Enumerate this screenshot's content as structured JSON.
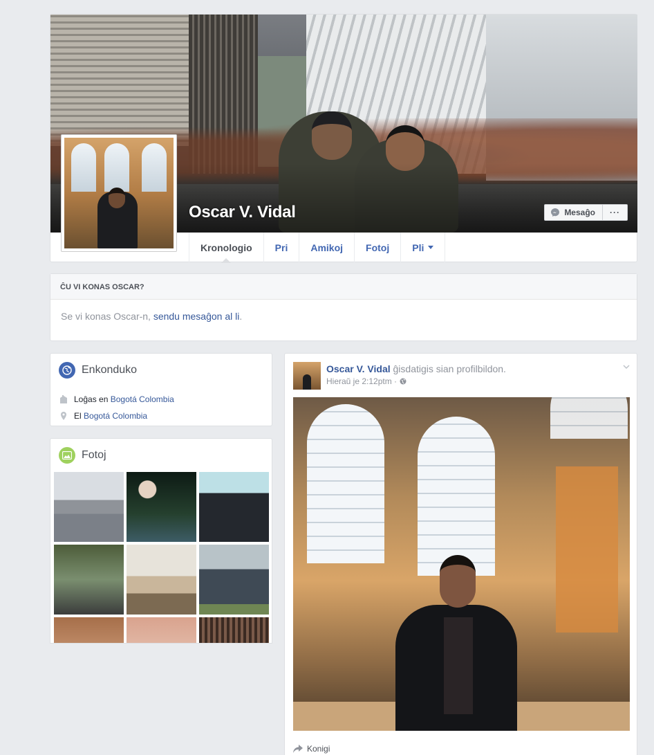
{
  "profile": {
    "name": "Oscar V. Vidal",
    "message_button": "Mesaĝo",
    "more_button": "···"
  },
  "tabs": [
    {
      "label": "Kronologio",
      "active": true
    },
    {
      "label": "Pri"
    },
    {
      "label": "Amikoj"
    },
    {
      "label": "Fotoj"
    },
    {
      "label": "Pli"
    }
  ],
  "know": {
    "header": "ĈU VI KONAS OSCAR?",
    "text": "Se vi konas Oscar-n,",
    "link": "sendu mesaĝon al li",
    "end": "."
  },
  "intro": {
    "title": "Enkonduko",
    "lives_prefix": "Loĝas en",
    "lives_link": "Bogotá Colombia",
    "from_prefix": "El",
    "from_link": "Bogotá Colombia",
    "icon_color": "#4267b2"
  },
  "photos": {
    "title": "Fotoj",
    "icon_color": "#9fd15e"
  },
  "post": {
    "author": "Oscar V. Vidal",
    "action": "ĝisdatigis sian profilbildon.",
    "time": "Hieraŭ je 2:12ptm ·",
    "share_label": "Konigi"
  }
}
